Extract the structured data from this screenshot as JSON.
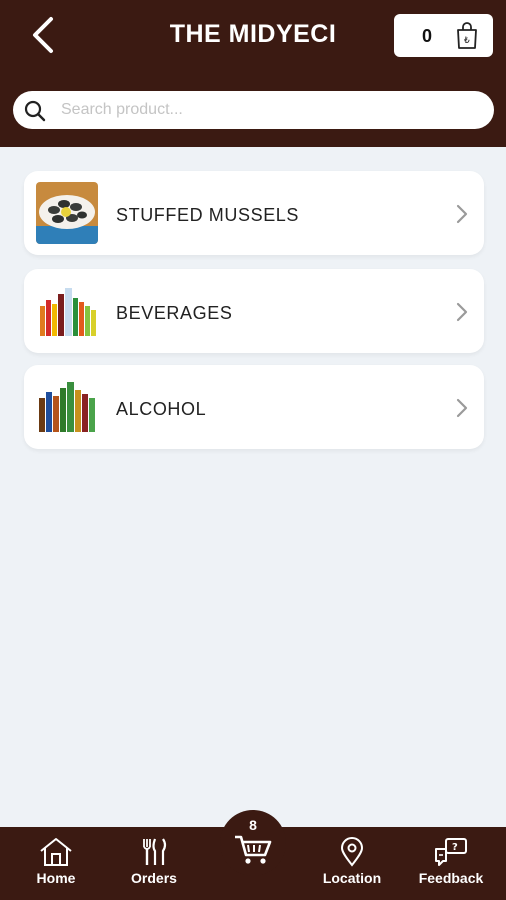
{
  "header": {
    "title": "THE MIDYECI",
    "cart_count": "0"
  },
  "search": {
    "placeholder": "Search product..."
  },
  "categories": [
    {
      "label": "STUFFED MUSSELS",
      "thumb": "mussels-thumbnail"
    },
    {
      "label": "BEVERAGES",
      "thumb": "beverages-thumbnail"
    },
    {
      "label": "ALCOHOL",
      "thumb": "alcohol-thumbnail"
    }
  ],
  "bottom_nav": {
    "home": "Home",
    "orders": "Orders",
    "cart_badge": "8",
    "location": "Location",
    "feedback": "Feedback"
  },
  "colors": {
    "brand": "#3b1a12",
    "background": "#eef2f6"
  }
}
